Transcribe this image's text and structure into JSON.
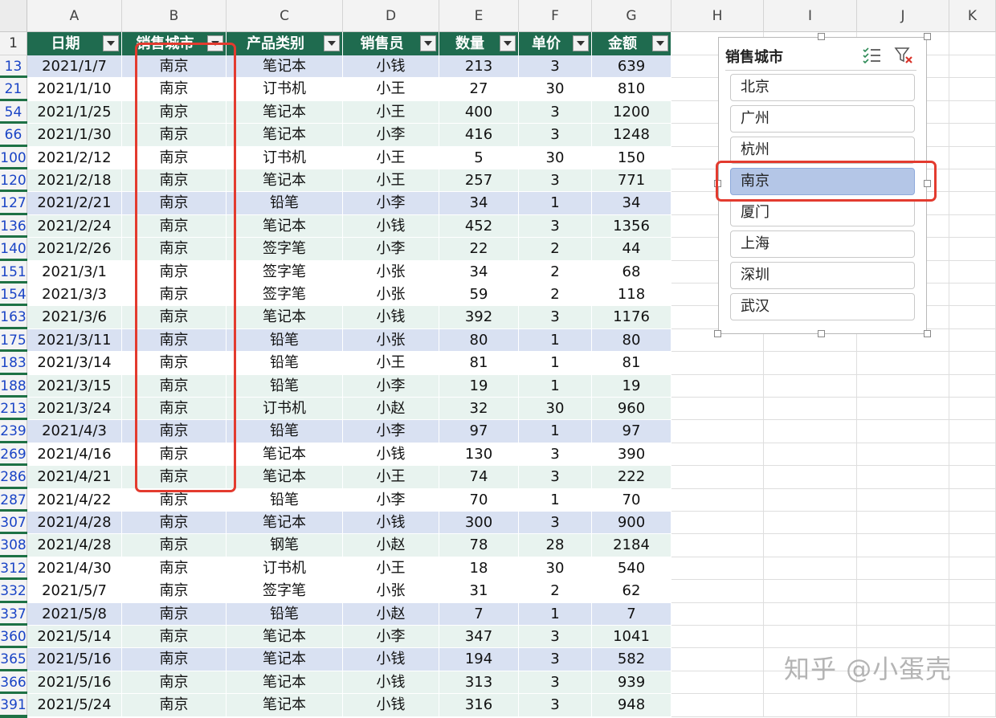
{
  "columns": [
    "A",
    "B",
    "C",
    "D",
    "E",
    "F",
    "G",
    "H",
    "I",
    "J",
    "K"
  ],
  "header_row_number": "1",
  "table_headers": [
    "日期",
    "销售城市",
    "产品类别",
    "销售员",
    "数量",
    "单价",
    "金额"
  ],
  "rows": [
    {
      "n": "13",
      "band": 0,
      "cells": [
        "2021/1/7",
        "南京",
        "笔记本",
        "小钱",
        "213",
        "3",
        "639"
      ]
    },
    {
      "n": "21",
      "band": 1,
      "cells": [
        "2021/1/10",
        "南京",
        "订书机",
        "小王",
        "27",
        "30",
        "810"
      ]
    },
    {
      "n": "54",
      "band": 2,
      "cells": [
        "2021/1/25",
        "南京",
        "笔记本",
        "小王",
        "400",
        "3",
        "1200"
      ]
    },
    {
      "n": "66",
      "band": 2,
      "cells": [
        "2021/1/30",
        "南京",
        "笔记本",
        "小李",
        "416",
        "3",
        "1248"
      ]
    },
    {
      "n": "100",
      "band": 1,
      "cells": [
        "2021/2/12",
        "南京",
        "订书机",
        "小王",
        "5",
        "30",
        "150"
      ]
    },
    {
      "n": "120",
      "band": 2,
      "cells": [
        "2021/2/18",
        "南京",
        "笔记本",
        "小王",
        "257",
        "3",
        "771"
      ]
    },
    {
      "n": "127",
      "band": 0,
      "cells": [
        "2021/2/21",
        "南京",
        "铅笔",
        "小李",
        "34",
        "1",
        "34"
      ]
    },
    {
      "n": "136",
      "band": 2,
      "cells": [
        "2021/2/24",
        "南京",
        "笔记本",
        "小钱",
        "452",
        "3",
        "1356"
      ]
    },
    {
      "n": "140",
      "band": 2,
      "cells": [
        "2021/2/26",
        "南京",
        "签字笔",
        "小李",
        "22",
        "2",
        "44"
      ]
    },
    {
      "n": "151",
      "band": 1,
      "cells": [
        "2021/3/1",
        "南京",
        "签字笔",
        "小张",
        "34",
        "2",
        "68"
      ]
    },
    {
      "n": "154",
      "band": 1,
      "cells": [
        "2021/3/3",
        "南京",
        "签字笔",
        "小张",
        "59",
        "2",
        "118"
      ]
    },
    {
      "n": "163",
      "band": 2,
      "cells": [
        "2021/3/6",
        "南京",
        "笔记本",
        "小钱",
        "392",
        "3",
        "1176"
      ]
    },
    {
      "n": "175",
      "band": 0,
      "cells": [
        "2021/3/11",
        "南京",
        "铅笔",
        "小张",
        "80",
        "1",
        "80"
      ]
    },
    {
      "n": "183",
      "band": 1,
      "cells": [
        "2021/3/14",
        "南京",
        "铅笔",
        "小王",
        "81",
        "1",
        "81"
      ]
    },
    {
      "n": "188",
      "band": 2,
      "cells": [
        "2021/3/15",
        "南京",
        "铅笔",
        "小李",
        "19",
        "1",
        "19"
      ]
    },
    {
      "n": "213",
      "band": 2,
      "cells": [
        "2021/3/24",
        "南京",
        "订书机",
        "小赵",
        "32",
        "30",
        "960"
      ]
    },
    {
      "n": "239",
      "band": 0,
      "cells": [
        "2021/4/3",
        "南京",
        "铅笔",
        "小李",
        "97",
        "1",
        "97"
      ]
    },
    {
      "n": "269",
      "band": 1,
      "cells": [
        "2021/4/16",
        "南京",
        "笔记本",
        "小钱",
        "130",
        "3",
        "390"
      ]
    },
    {
      "n": "286",
      "band": 2,
      "cells": [
        "2021/4/21",
        "南京",
        "笔记本",
        "小王",
        "74",
        "3",
        "222"
      ]
    },
    {
      "n": "287",
      "band": 1,
      "cells": [
        "2021/4/22",
        "南京",
        "铅笔",
        "小李",
        "70",
        "1",
        "70"
      ]
    },
    {
      "n": "307",
      "band": 0,
      "cells": [
        "2021/4/28",
        "南京",
        "笔记本",
        "小钱",
        "300",
        "3",
        "900"
      ]
    },
    {
      "n": "308",
      "band": 2,
      "cells": [
        "2021/4/28",
        "南京",
        "钢笔",
        "小赵",
        "78",
        "28",
        "2184"
      ]
    },
    {
      "n": "312",
      "band": 1,
      "cells": [
        "2021/4/30",
        "南京",
        "订书机",
        "小王",
        "18",
        "30",
        "540"
      ]
    },
    {
      "n": "332",
      "band": 1,
      "cells": [
        "2021/5/7",
        "南京",
        "签字笔",
        "小张",
        "31",
        "2",
        "62"
      ]
    },
    {
      "n": "337",
      "band": 0,
      "cells": [
        "2021/5/8",
        "南京",
        "铅笔",
        "小赵",
        "7",
        "1",
        "7"
      ]
    },
    {
      "n": "360",
      "band": 2,
      "cells": [
        "2021/5/14",
        "南京",
        "笔记本",
        "小李",
        "347",
        "3",
        "1041"
      ]
    },
    {
      "n": "365",
      "band": 0,
      "cells": [
        "2021/5/16",
        "南京",
        "笔记本",
        "小钱",
        "194",
        "3",
        "582"
      ]
    },
    {
      "n": "366",
      "band": 2,
      "cells": [
        "2021/5/16",
        "南京",
        "笔记本",
        "小钱",
        "313",
        "3",
        "939"
      ]
    },
    {
      "n": "391",
      "band": 2,
      "cells": [
        "2021/5/24",
        "南京",
        "笔记本",
        "小钱",
        "316",
        "3",
        "948"
      ]
    }
  ],
  "slicer": {
    "title": "销售城市",
    "items": [
      "北京",
      "广州",
      "杭州",
      "南京",
      "厦门",
      "上海",
      "深圳",
      "武汉"
    ],
    "selected": "南京"
  },
  "colors": {
    "header_green": "#1f6b4f",
    "band_blue": "#d9e1f2",
    "band_green": "#e8f3ef",
    "slicer_selected": "#b4c6e7",
    "highlight_red": "#e33b2f"
  },
  "watermark": "知乎 @小蛋壳"
}
